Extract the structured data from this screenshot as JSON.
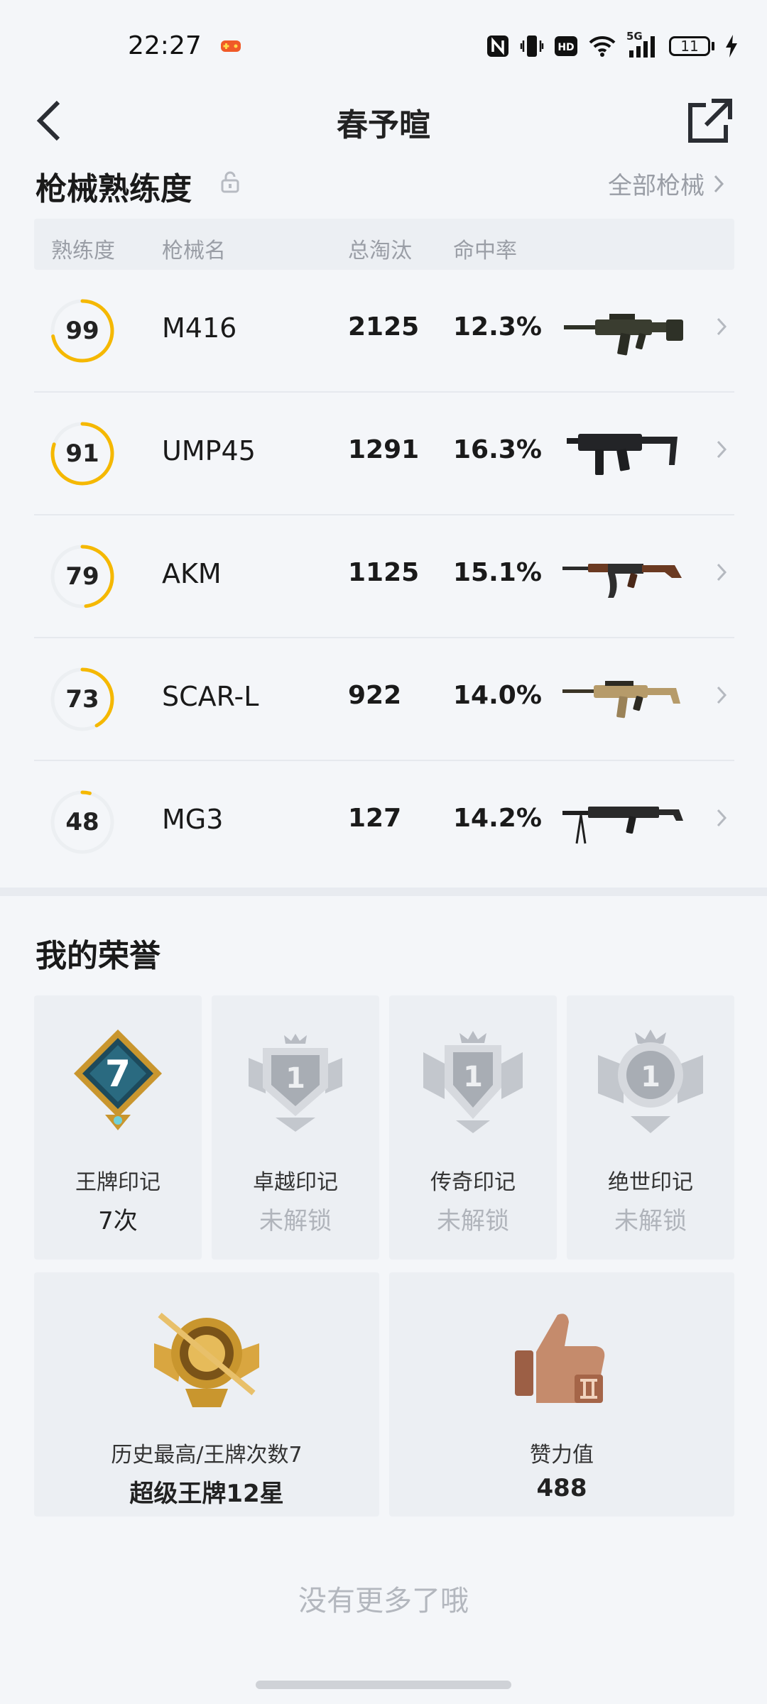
{
  "status_bar": {
    "time": "22:27",
    "network": "5G",
    "hd": "HD",
    "battery": "11"
  },
  "nav": {
    "title": "春予暄"
  },
  "weapons": {
    "title": "枪械熟练度",
    "all_link": "全部枪械",
    "headers": {
      "proficiency": "熟练度",
      "name": "枪械名",
      "kills": "总淘汰",
      "hit_rate": "命中率"
    },
    "rows": [
      {
        "proficiency": "99",
        "name": "M416",
        "kills": "2125",
        "hit_rate": "12.3%",
        "progress": 0.72
      },
      {
        "proficiency": "91",
        "name": "UMP45",
        "kills": "1291",
        "hit_rate": "16.3%",
        "progress": 0.8
      },
      {
        "proficiency": "79",
        "name": "AKM",
        "kills": "1125",
        "hit_rate": "15.1%",
        "progress": 0.48
      },
      {
        "proficiency": "73",
        "name": "SCAR-L",
        "kills": "922",
        "hit_rate": "14.0%",
        "progress": 0.42
      },
      {
        "proficiency": "48",
        "name": "MG3",
        "kills": "127",
        "hit_rate": "14.2%",
        "progress": 0.04
      }
    ]
  },
  "honor": {
    "title": "我的荣誉",
    "cards": [
      {
        "label": "王牌印记",
        "value": "7次",
        "badge": "7"
      },
      {
        "label": "卓越印记",
        "value": "未解锁",
        "badge": "1"
      },
      {
        "label": "传奇印记",
        "value": "未解锁",
        "badge": "1"
      },
      {
        "label": "绝世印记",
        "value": "未解锁",
        "badge": "1"
      }
    ],
    "rank": {
      "label": "历史最高/王牌次数7",
      "value": "超级王牌12星"
    },
    "likes": {
      "label": "赞力值",
      "value": "488"
    }
  },
  "footer": {
    "no_more": "没有更多了哦"
  },
  "colors": {
    "ring_active": "#f5b800",
    "ring_track": "#eceff2",
    "gold": "#c9962e",
    "silver": "#a8adb4",
    "bronze": "#b87955"
  }
}
